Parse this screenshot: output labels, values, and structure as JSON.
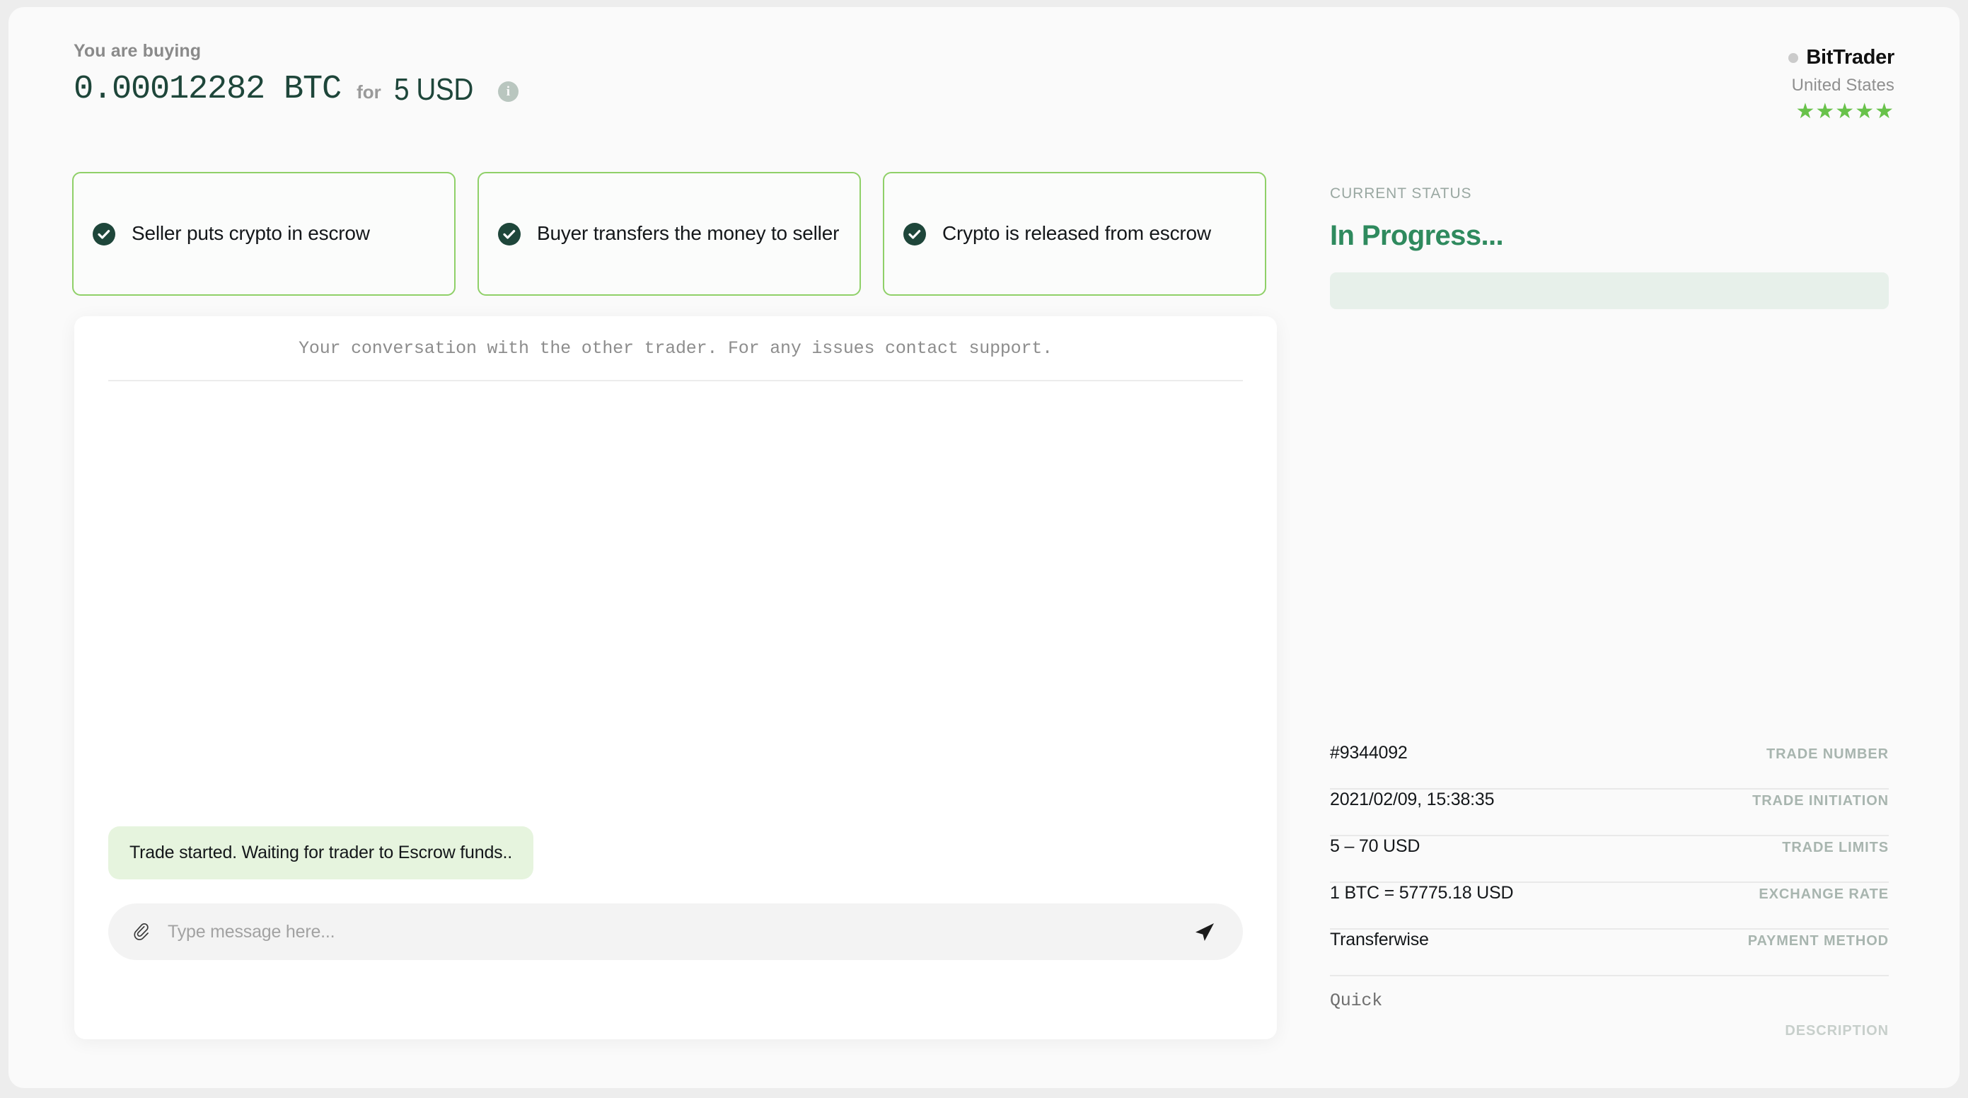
{
  "header": {
    "buying_label": "You are buying",
    "crypto_amount": "0.00012282 BTC",
    "for_label": "for",
    "fiat_amount": "5 USD",
    "info_icon_glyph": "i",
    "info_icon_name": "info-icon"
  },
  "merchant": {
    "name": "BitTrader",
    "country": "United States",
    "rating_stars": "★★★★★",
    "rating_count": 5,
    "online_status": "offline",
    "dot_color": "#cbcbcb",
    "star_color": "#68c24a"
  },
  "steps": [
    {
      "label": "Seller puts crypto in escrow",
      "completed": true
    },
    {
      "label": "Buyer transfers the money to seller",
      "completed": true
    },
    {
      "label": "Crypto is released from escrow",
      "completed": true
    }
  ],
  "chat": {
    "header_note": "Your conversation with the other trader. For any issues contact support.",
    "messages": [
      {
        "text": "Trade started. Waiting for trader to Escrow funds..",
        "side": "incoming"
      }
    ],
    "input_placeholder": "Type message here...",
    "input_value": "",
    "attach_icon": "paperclip-icon",
    "send_icon": "send-icon"
  },
  "status": {
    "label": "CURRENT STATUS",
    "value": "In Progress...",
    "accent_color": "#2f8a5e",
    "panel_color": "#e7f0ea"
  },
  "details": [
    {
      "value": "#9344092",
      "key": "TRADE NUMBER"
    },
    {
      "value": "2021/02/09, 15:38:35",
      "key": "TRADE INITIATION"
    },
    {
      "value": "5 – 70 USD",
      "key": "TRADE LIMITS"
    },
    {
      "value": "1 BTC = 57775.18 USD",
      "key": "EXCHANGE RATE"
    },
    {
      "value": "Transferwise",
      "key": "PAYMENT METHOD"
    },
    {
      "value": "Quick",
      "key": "DESCRIPTION"
    }
  ],
  "theme": {
    "page_background": "#ededed",
    "card_background": "#fafafa",
    "step_border": "#8fd068",
    "dark_green": "#1e463a",
    "bubble_green": "#e6f4de"
  }
}
